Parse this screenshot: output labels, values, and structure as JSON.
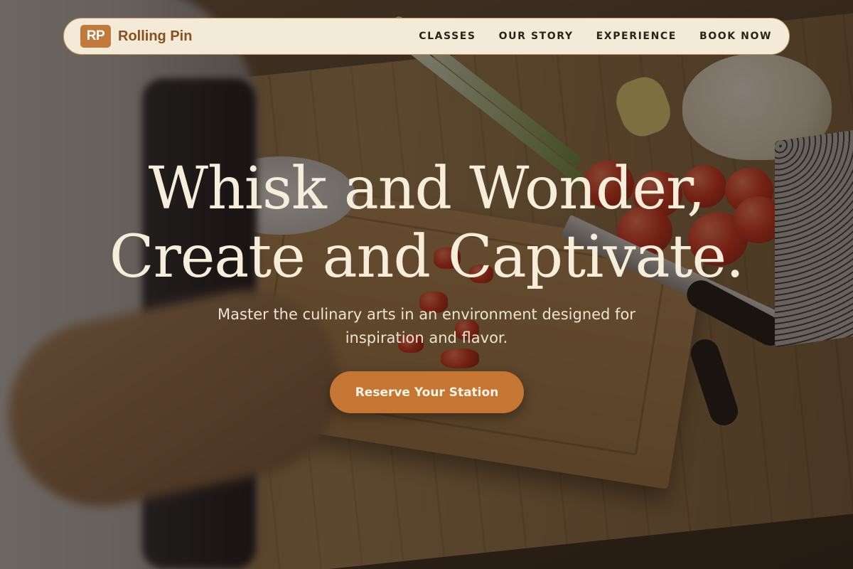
{
  "brand": {
    "badge": "RP",
    "name": "Rolling Pin"
  },
  "nav": {
    "items": [
      {
        "label": "CLASSES"
      },
      {
        "label": "OUR STORY"
      },
      {
        "label": "EXPERIENCE"
      },
      {
        "label": "BOOK NOW"
      }
    ]
  },
  "hero": {
    "headline_line1": "Whisk and Wonder,",
    "headline_line2": "Create and Captivate.",
    "subtitle_line1": "Master the culinary arts in an environment designed for",
    "subtitle_line2": "inspiration and flavor.",
    "cta_label": "Reserve Your Station"
  },
  "colors": {
    "accent": "#c47632",
    "nav_background": "#f3ead7",
    "brand_text": "#8a4f1e",
    "headline": "#f6eedb"
  }
}
